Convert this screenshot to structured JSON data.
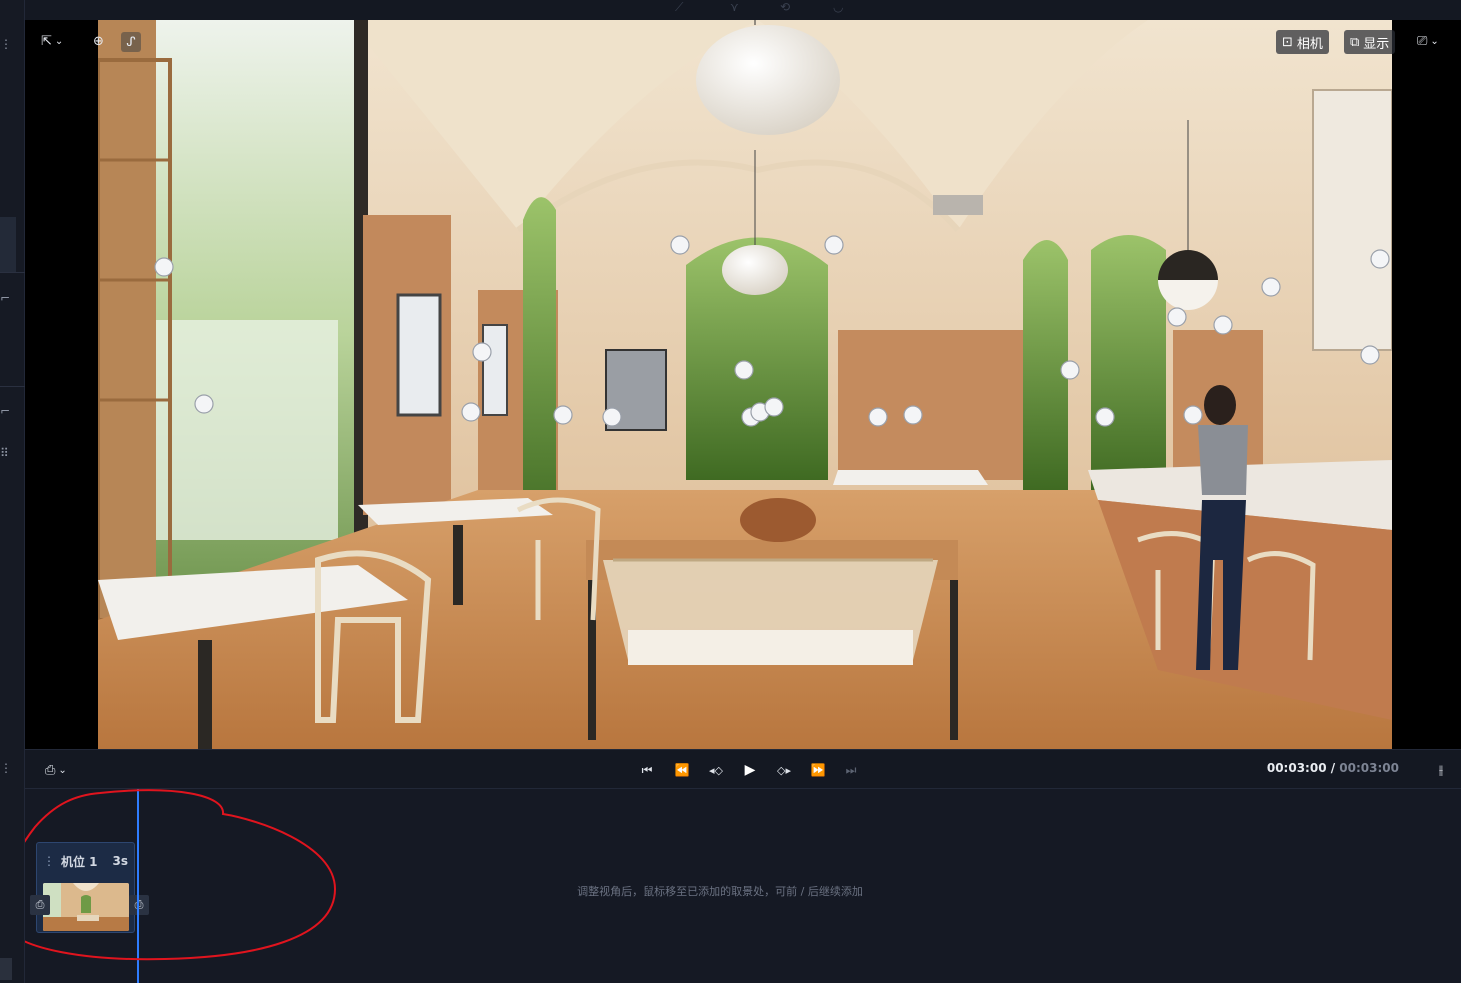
{
  "viewport": {
    "camera_label": "相机",
    "display_label": "显示",
    "scene_image": "restaurant interior with arched ceilings, bistro tables, wicker chairs, bar counter and woman standing",
    "hotspot_icon": "waypoint-marker-icon"
  },
  "playback": {
    "current_time": "00:03:00",
    "separator": " / ",
    "total_time": "00:03:00"
  },
  "timeline": {
    "clip_name": "机位 1",
    "clip_duration": "3s",
    "hint": "调整视角后，鼠标移至已添加的取景处，可前 / 后继续添加"
  },
  "colors": {
    "background": "#141822",
    "playhead": "#2f7dff",
    "clip_fill": "#1c2b45",
    "annotation": "#e0141e"
  }
}
